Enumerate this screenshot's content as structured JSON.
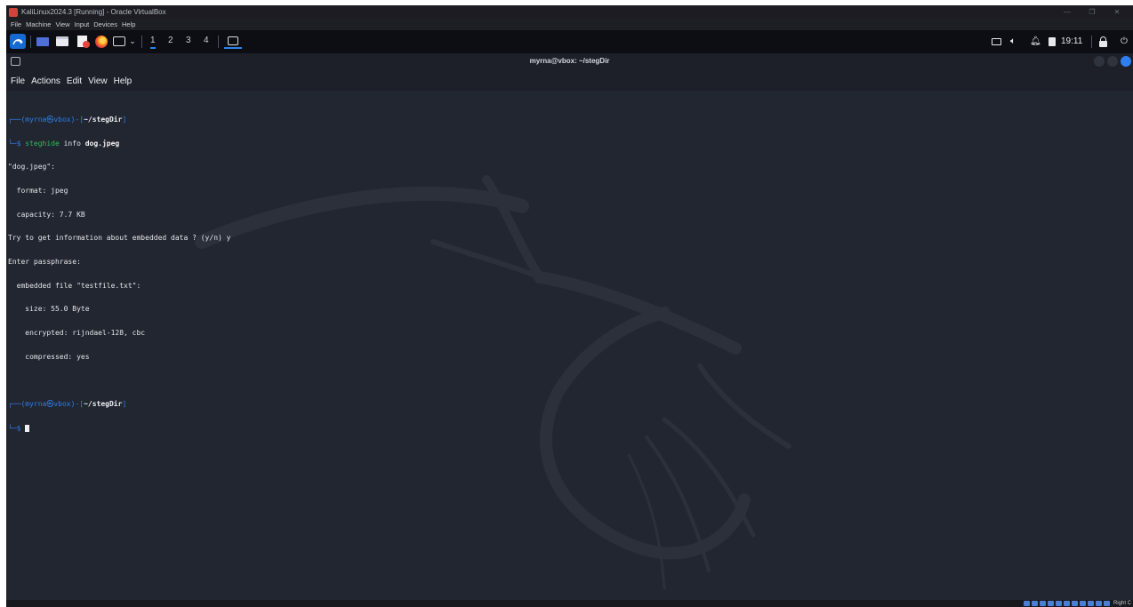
{
  "vbox": {
    "window_title": "KaliLinux2024.3 [Running] - Oracle VirtualBox",
    "menu": [
      "File",
      "Machine",
      "View",
      "Input",
      "Devices",
      "Help"
    ],
    "window_controls": [
      "—",
      "❐",
      "✕"
    ],
    "host_key": "Right C"
  },
  "panel": {
    "workspaces": [
      "1",
      "2",
      "3",
      "4"
    ],
    "active_workspace": "1",
    "clock": "19:11",
    "icons": [
      "kali-menu-icon",
      "desktop-icon",
      "file-manager-icon",
      "text-editor-icon",
      "firefox-icon",
      "terminal-icon",
      "terminal-dropdown-icon",
      "screen-icon",
      "volume-icon",
      "notification-bell-icon",
      "battery-icon",
      "lock-icon",
      "power-icon"
    ]
  },
  "terminal": {
    "title": "myrna@vbox: ~/stegDir",
    "menu": [
      "File",
      "Actions",
      "Edit",
      "View",
      "Help"
    ],
    "prompt1": {
      "top": "┌──(",
      "user": "myrna㉿vbox",
      "sep": ")-[",
      "path": "~/stegDir",
      "end": "]"
    },
    "cmd1": {
      "marker": "└─$ ",
      "program": "steghide",
      "args": " info ",
      "file": "dog.jpeg"
    },
    "output": [
      "\"dog.jpeg\":",
      "  format: jpeg",
      "  capacity: 7.7 KB",
      "Try to get information about embedded data ? (y/n) y",
      "Enter passphrase:",
      "  embedded file \"testfile.txt\":",
      "    size: 55.0 Byte",
      "    encrypted: rijndael-128, cbc",
      "    compressed: yes"
    ],
    "prompt2": {
      "top": "┌──(",
      "user": "myrna㉿vbox",
      "sep": ")-[",
      "path": "~/stegDir",
      "end": "]"
    },
    "cmd2": {
      "marker": "└─$ "
    }
  },
  "colors": {
    "accent": "#2b7fe9",
    "command": "#2bbf5a",
    "terminal_bg": "#222631"
  }
}
